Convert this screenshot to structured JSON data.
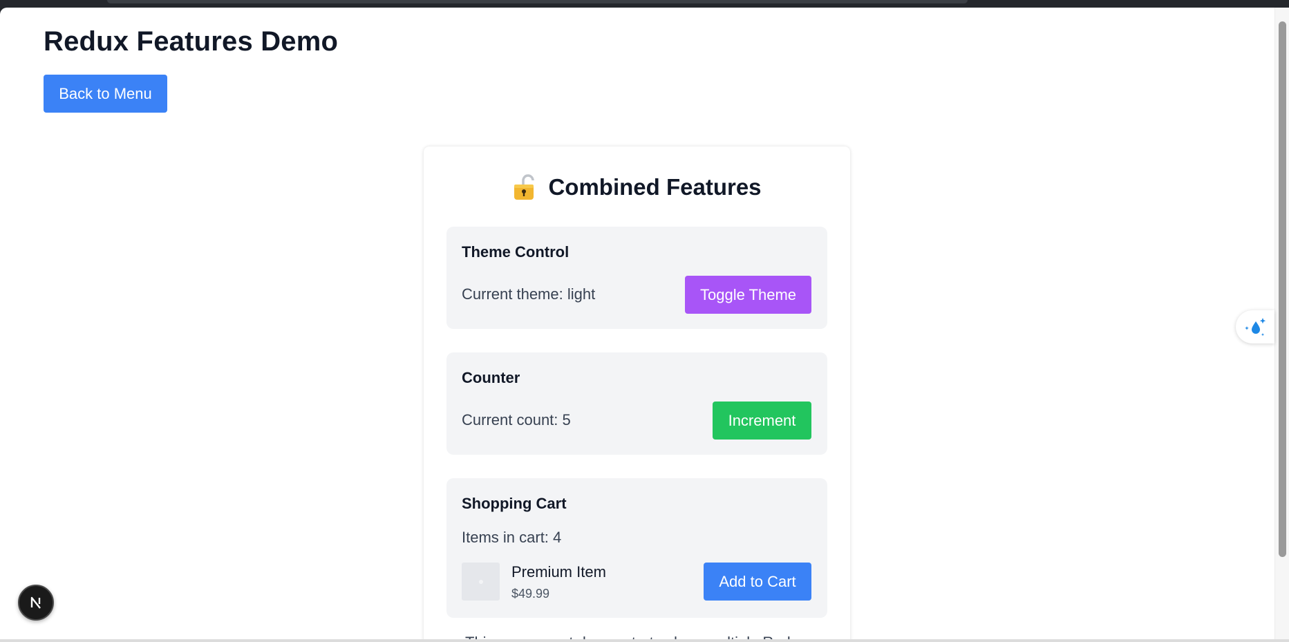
{
  "page": {
    "title": "Redux Features Demo",
    "back_label": "Back to Menu"
  },
  "card": {
    "title": "Combined Features",
    "theme": {
      "heading": "Theme Control",
      "status": "Current theme: light",
      "button_label": "Toggle Theme"
    },
    "counter": {
      "heading": "Counter",
      "status": "Current count: 5",
      "button_label": "Increment"
    },
    "cart": {
      "heading": "Shopping Cart",
      "status": "Items in cart: 4",
      "item_name": "Premium Item",
      "item_price": "$49.99",
      "button_label": "Add to Cart"
    },
    "footer_text": "This component demonstrates how multiple Redux"
  },
  "colors": {
    "primary": "#3b82f6",
    "purple": "#a855f7",
    "green": "#22c55e",
    "section_bg": "#f3f4f6",
    "text_dark": "#111827"
  },
  "icons": {
    "card_title": "lock-icon",
    "dev_badge": "nextjs-logo-icon",
    "side_widget": "water-drop-sparkle-icon"
  }
}
